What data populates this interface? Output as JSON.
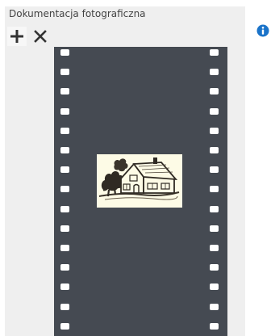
{
  "panel": {
    "title": "Dokumentacja fotograficzna"
  },
  "toolbar": {
    "add_icon": "plus-icon",
    "remove_icon": "close-icon",
    "info_icon": "info-icon"
  },
  "colors": {
    "panel_background": "#efefef",
    "film_strip": "#454a52",
    "info_accent": "#1a73c9",
    "photo_background": "#fdfbe6"
  },
  "photos": [
    {
      "icon": "house-sketch-icon"
    }
  ]
}
